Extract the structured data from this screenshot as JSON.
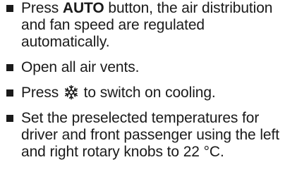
{
  "instructions": [
    {
      "pre": "Press ",
      "bold": "AUTO",
      "post": " button, the air distribution and fan speed are regulated automatically."
    },
    {
      "text": "Open all air vents."
    },
    {
      "pre": "Press ",
      "icon": "cooling-snowflake-icon",
      "post": " to switch on cooling."
    },
    {
      "text": "Set the preselected temperatures for driver and front passenger using the left and right rotary knobs to 22 °C."
    }
  ],
  "colors": {
    "text": "#1a1a1a",
    "background": "#ffffff"
  }
}
